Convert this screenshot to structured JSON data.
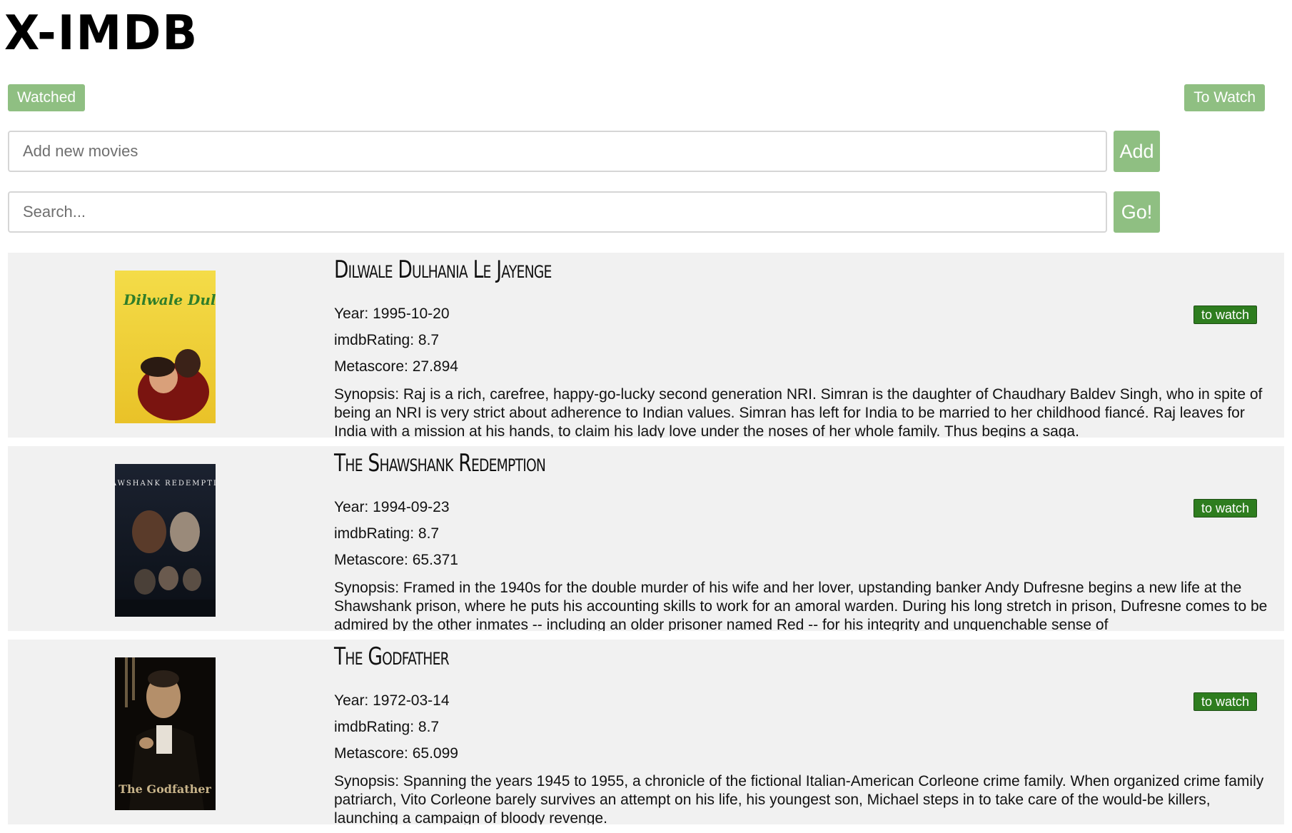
{
  "app": {
    "logo": "X-IMDB"
  },
  "nav": {
    "watched_label": "Watched",
    "to_watch_label": "To Watch"
  },
  "add_form": {
    "placeholder": "Add new movies",
    "button_label": "Add"
  },
  "search_form": {
    "placeholder": "Search...",
    "button_label": "Go!"
  },
  "movies": [
    {
      "title": "Dilwale Dulhania Le Jayenge",
      "year": "Year: 1995-10-20",
      "rating": "imdbRating: 8.7",
      "metascore": "Metascore: 27.894",
      "synopsis": "Synopsis: Raj is a rich, carefree, happy-go-lucky second generation NRI. Simran is the daughter of Chaudhary Baldev Singh, who in spite of being an NRI is very strict about adherence to Indian values. Simran has left for India to be married to her childhood fiancé. Raj leaves for India with a mission at his hands, to claim his lady love under the noses of her whole family. Thus begins a saga.",
      "button_label": "to watch",
      "poster_text": "Dilwale Dulhania Le Jayenge"
    },
    {
      "title": "The Shawshank Redemption",
      "year": "Year: 1994-09-23",
      "rating": "imdbRating: 8.7",
      "metascore": "Metascore: 65.371",
      "synopsis": "Synopsis: Framed in the 1940s for the double murder of his wife and her lover, upstanding banker Andy Dufresne begins a new life at the Shawshank prison, where he puts his accounting skills to work for an amoral warden. During his long stretch in prison, Dufresne comes to be admired by the other inmates -- including an older prisoner named Red -- for his integrity and unquenchable sense of",
      "button_label": "to watch",
      "poster_text": "SHAWSHANK REDEMPTION"
    },
    {
      "title": "The Godfather",
      "year": "Year: 1972-03-14",
      "rating": "imdbRating: 8.7",
      "metascore": "Metascore: 65.099",
      "synopsis": "Synopsis: Spanning the years 1945 to 1955, a chronicle of the fictional Italian-American Corleone crime family. When organized crime family patriarch, Vito Corleone barely survives an attempt on his life, his youngest son, Michael steps in to take care of the would-be killers, launching a campaign of bloody revenge.",
      "button_label": "to watch",
      "poster_text": "The Godfather"
    }
  ],
  "colors": {
    "nav_button": "#8fbf82",
    "to_watch_button": "#2e7d1f",
    "card_background": "#f1f1f1"
  }
}
